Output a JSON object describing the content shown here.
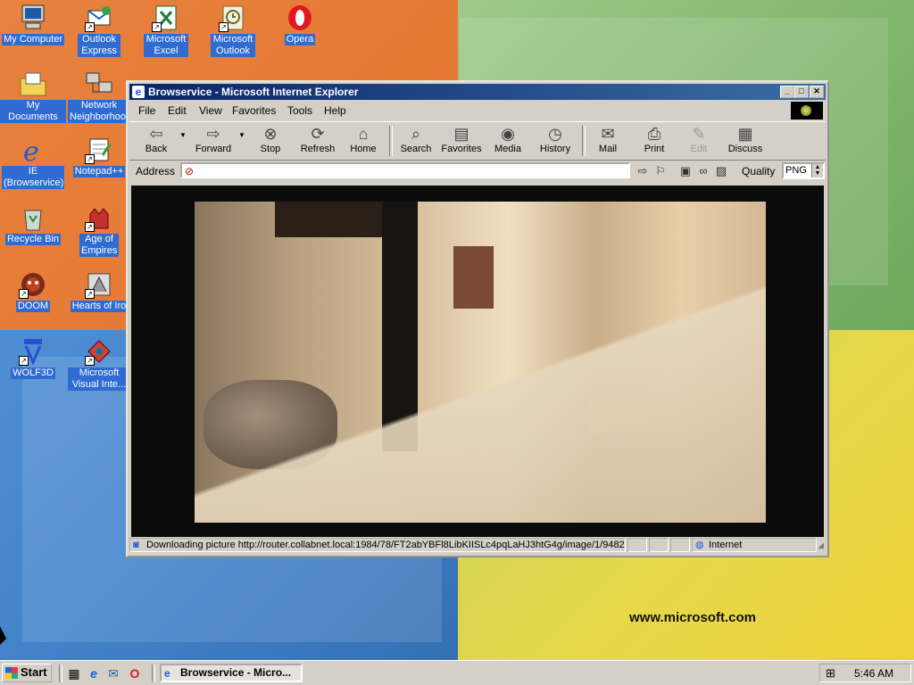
{
  "desktop": {
    "icons": [
      {
        "label": "My Computer"
      },
      {
        "label": "Outlook Express"
      },
      {
        "label": "Microsoft Excel"
      },
      {
        "label": "Microsoft Outlook"
      },
      {
        "label": "Opera"
      },
      {
        "label": "My Documents"
      },
      {
        "label": "Network Neighborhood"
      },
      {
        "label": "IE (Browservice)"
      },
      {
        "label": "Notepad++"
      },
      {
        "label": "Recycle Bin"
      },
      {
        "label": "Age of Empires"
      },
      {
        "label": "DOOM"
      },
      {
        "label": "Hearts of Iro"
      },
      {
        "label": "WOLF3D"
      },
      {
        "label": "Microsoft Visual Inte..."
      }
    ],
    "wallpaper_text": "www.microsoft.com"
  },
  "window": {
    "title": "Browservice - Microsoft Internet Explorer",
    "controls": {
      "minimize": "_",
      "maximize": "□",
      "close": "✕"
    }
  },
  "menu": [
    "File",
    "Edit",
    "View",
    "Favorites",
    "Tools",
    "Help"
  ],
  "toolbar": {
    "back": "Back",
    "forward": "Forward",
    "stop": "Stop",
    "refresh": "Refresh",
    "home": "Home",
    "search": "Search",
    "favorites": "Favorites",
    "media": "Media",
    "history": "History",
    "mail": "Mail",
    "print": "Print",
    "edit": "Edit",
    "discuss": "Discuss"
  },
  "address": {
    "label": "Address",
    "value": ""
  },
  "quality": {
    "label": "Quality",
    "value": "PNG"
  },
  "status": {
    "text": "Downloading picture http://router.collabnet.local:1984/78/FT2abYBFl8LibKIISLc4pqLaHJ3htG4g/image/1/9482/(",
    "zone": "Internet"
  },
  "taskbar": {
    "start": "Start",
    "task": "Browservice - Micro...",
    "clock": "5:46 AM"
  },
  "colors": {
    "titlebar": "#0a246a",
    "chrome": "#d4d0c8",
    "icon_label_bg": "#2f6bd0"
  }
}
